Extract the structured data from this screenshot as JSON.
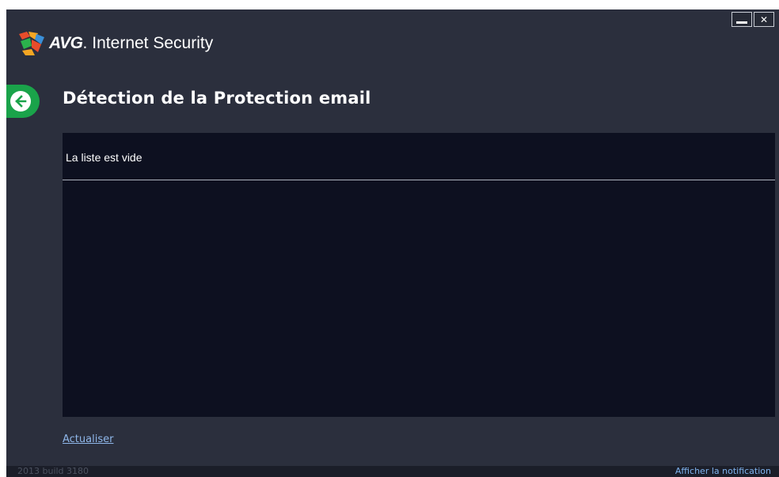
{
  "window": {
    "brand_name": "AVG",
    "brand_dot": ".",
    "product_name": "Internet Security",
    "minimize_icon": "minimize-icon",
    "close_icon": "close-icon",
    "close_glyph": "✕"
  },
  "page": {
    "back_icon": "arrow-left-icon",
    "title": "Détection de la Protection email"
  },
  "list": {
    "empty_message": "La liste est vide"
  },
  "actions": {
    "refresh_label": "Actualiser"
  },
  "footer": {
    "build": "2013  build 3180",
    "notification_link": "Afficher la notification"
  },
  "colors": {
    "window_bg": "#2b2f3d",
    "panel_bg": "#0d1020",
    "accent_green": "#1aa34a",
    "link_blue": "#8fb7ea"
  }
}
